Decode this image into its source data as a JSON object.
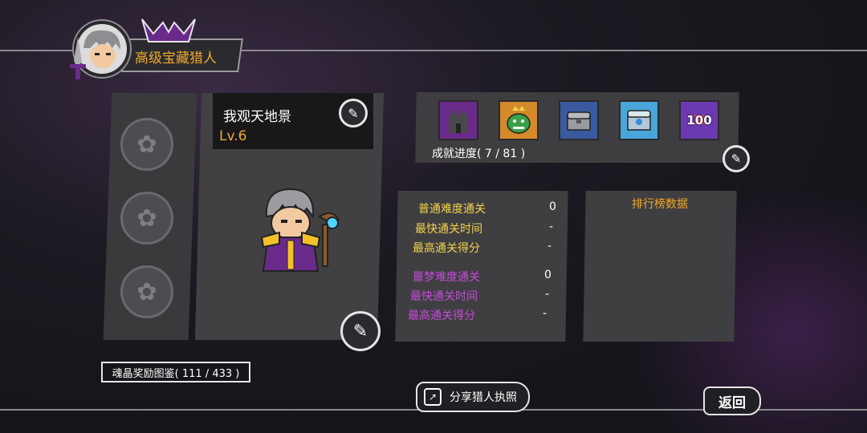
{
  "header": {
    "title": "高级宝藏猎人"
  },
  "hero": {
    "name": "我观天地景",
    "level": "Lv.6"
  },
  "achievements": {
    "icons": [
      "dark-castle-icon",
      "goblin-king-icon",
      "treasure-chest-icon",
      "frozen-chest-icon",
      "hundred-badge-icon"
    ],
    "badge_text": "100",
    "progress": "成就进度( 7 / 81 )"
  },
  "stats": {
    "normal": {
      "clear_label": "普通难度通关",
      "clear_value": "0",
      "fastest_label": "最快通关时间",
      "fastest_value": "-",
      "score_label": "最高通关得分",
      "score_value": "-"
    },
    "nightmare": {
      "clear_label": "噩梦难度通关",
      "clear_value": "0",
      "fastest_label": "最快通关时间",
      "fastest_value": "-",
      "score_label": "最高通关得分",
      "score_value": "-"
    }
  },
  "leaderboard": {
    "title": "排行榜数据"
  },
  "soul_crystal": {
    "label": "魂晶奖励图鉴( 111 / 433 )"
  },
  "buttons": {
    "share": "分享猎人执照",
    "back": "返回"
  },
  "colors": {
    "accent_orange": "#f0a82a",
    "normal_yellow": "#f3d24a",
    "nightmare_purple": "#c54bd8",
    "panel_gray": "#3f3f42"
  }
}
